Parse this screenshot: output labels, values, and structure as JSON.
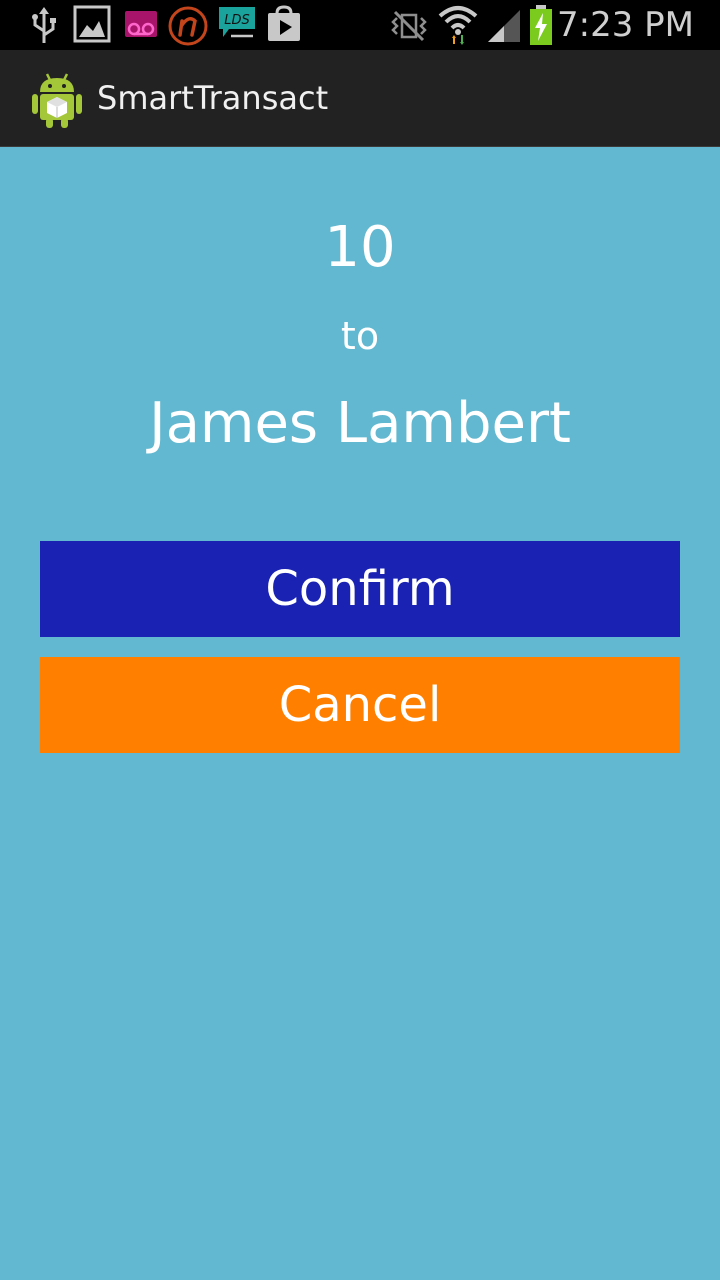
{
  "status_bar": {
    "time": "7:23 PM",
    "notification_icons": [
      "usb-icon",
      "gallery-icon",
      "voicemail-icon",
      "n-app-icon",
      "lds-chat-icon",
      "play-store-icon"
    ],
    "system_icons": [
      "vibrate-off-icon",
      "wifi-icon",
      "signal-icon",
      "battery-charging-icon"
    ],
    "lds_label": "LDS"
  },
  "action_bar": {
    "app_icon": "android-robot-icon",
    "title": "SmartTransact"
  },
  "transaction": {
    "amount": "10",
    "to_label": "to",
    "recipient": "James Lambert"
  },
  "buttons": {
    "confirm_label": "Confirm",
    "cancel_label": "Cancel"
  },
  "colors": {
    "background": "#62b8d0",
    "confirm": "#1a22b4",
    "cancel": "#ff8000",
    "action_bar": "#222222"
  }
}
